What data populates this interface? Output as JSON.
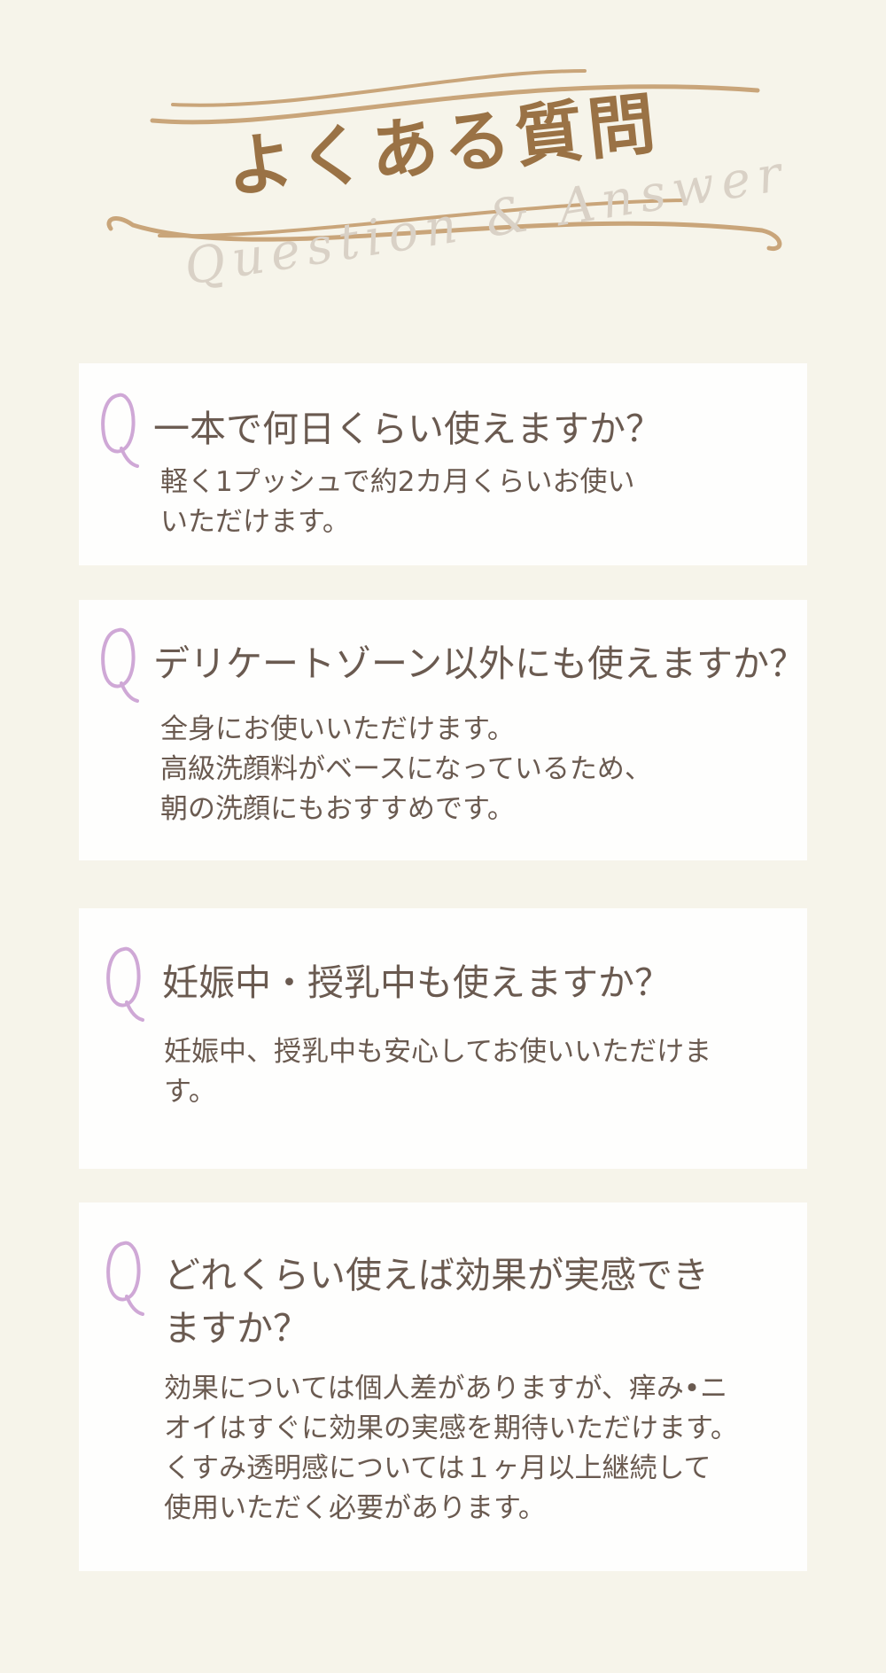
{
  "header": {
    "title": "よくある質問",
    "subtitle": "Question & Answer"
  },
  "colors": {
    "background": "#f6f4ea",
    "card": "#fefefd",
    "title": "#9a7245",
    "ornament": "#c9a57a",
    "q_mark": "#cfa8d6",
    "text": "#6a5a50",
    "subtitle": "#d9d1c6"
  },
  "faqs": [
    {
      "q_icon": "letter-q-icon",
      "question_lines": [
        "一本で何日くらい使えますか？"
      ],
      "answer_lines": [
        "軽く1プッシュで約2カ月くらいお使い",
        "いただけます。"
      ]
    },
    {
      "q_icon": "letter-q-icon",
      "question_lines": [
        "デリケートゾーン以外にも使えますか？"
      ],
      "answer_lines": [
        "全身にお使いいただけます。",
        "高級洗顔料がベースになっているため、",
        "朝の洗顔にもおすすめです。"
      ]
    },
    {
      "q_icon": "letter-q-icon",
      "question_lines": [
        "妊娠中・授乳中も使えますか？"
      ],
      "answer_lines": [
        "妊娠中、授乳中も安心してお使いいただけま",
        "す。"
      ]
    },
    {
      "q_icon": "letter-q-icon",
      "question_lines": [
        "どれくらい使えば効果が実感でき",
        "ますか？"
      ],
      "answer_lines": [
        "効果については個人差がありますが、痒み•ニ",
        "オイはすぐに効果の実感を期待いただけます。",
        "くすみ透明感については１ヶ月以上継続して",
        "使用いただく必要があります。"
      ]
    }
  ]
}
